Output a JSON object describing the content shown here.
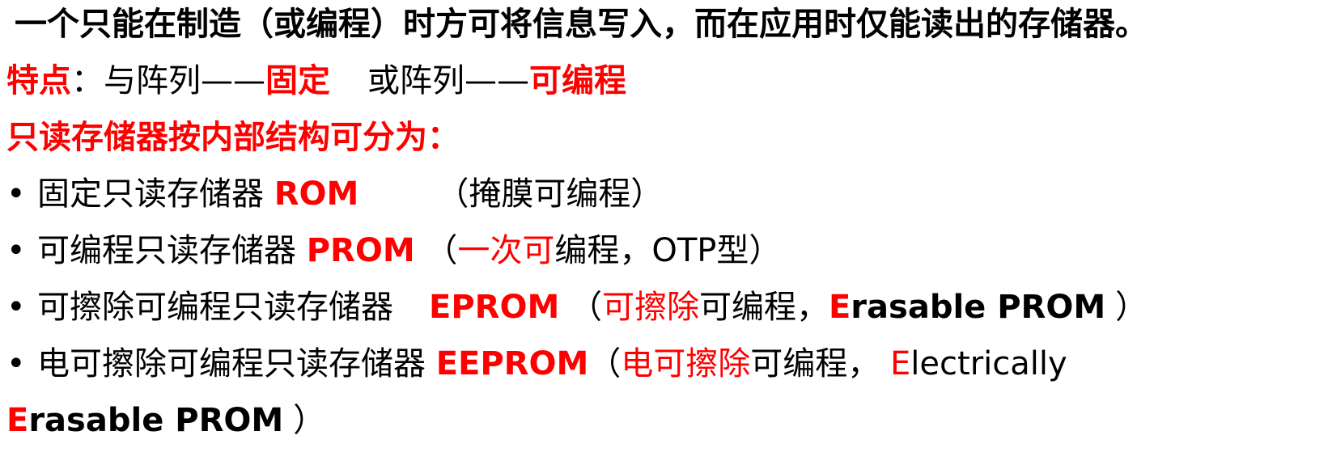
{
  "definition": "一个只能在制造（或编程）时方可将信息写入，而在应用时仅能读出的存储器。",
  "features": {
    "label": "特点",
    "colon": "：",
    "and_array": "与阵列——",
    "fixed": "固定",
    "or_array": "或阵列——",
    "programmable": "可编程"
  },
  "classification_heading": "只读存储器按内部结构可分为：",
  "bullet_symbol": "•",
  "items": [
    {
      "name": "固定只读存储器",
      "abbr": "ROM",
      "note_open": "（",
      "note": "掩膜可编程",
      "note_close": "）"
    },
    {
      "name": "可编程只读存储器",
      "abbr": "PROM",
      "note_open": "（",
      "note_red": "一次可",
      "note": "编程，OTP型",
      "note_close": "）"
    },
    {
      "name": "可擦除可编程只读存储器",
      "abbr": "EPROM",
      "note_open": "（",
      "note_red": "可擦除",
      "note": "可编程，",
      "eng_first": "E",
      "eng_rest": "rasable PROM",
      "note_close": "）"
    },
    {
      "name": "电可擦除可编程只读存储器",
      "abbr": "EEPROM",
      "note_open": "（",
      "note_red": "电可擦除",
      "note": "可编程，",
      "eng_first": "E",
      "eng_rest": "lectrically",
      "eng2_first": "E",
      "eng2_rest": "rasable PROM",
      "note_close": "）"
    }
  ]
}
